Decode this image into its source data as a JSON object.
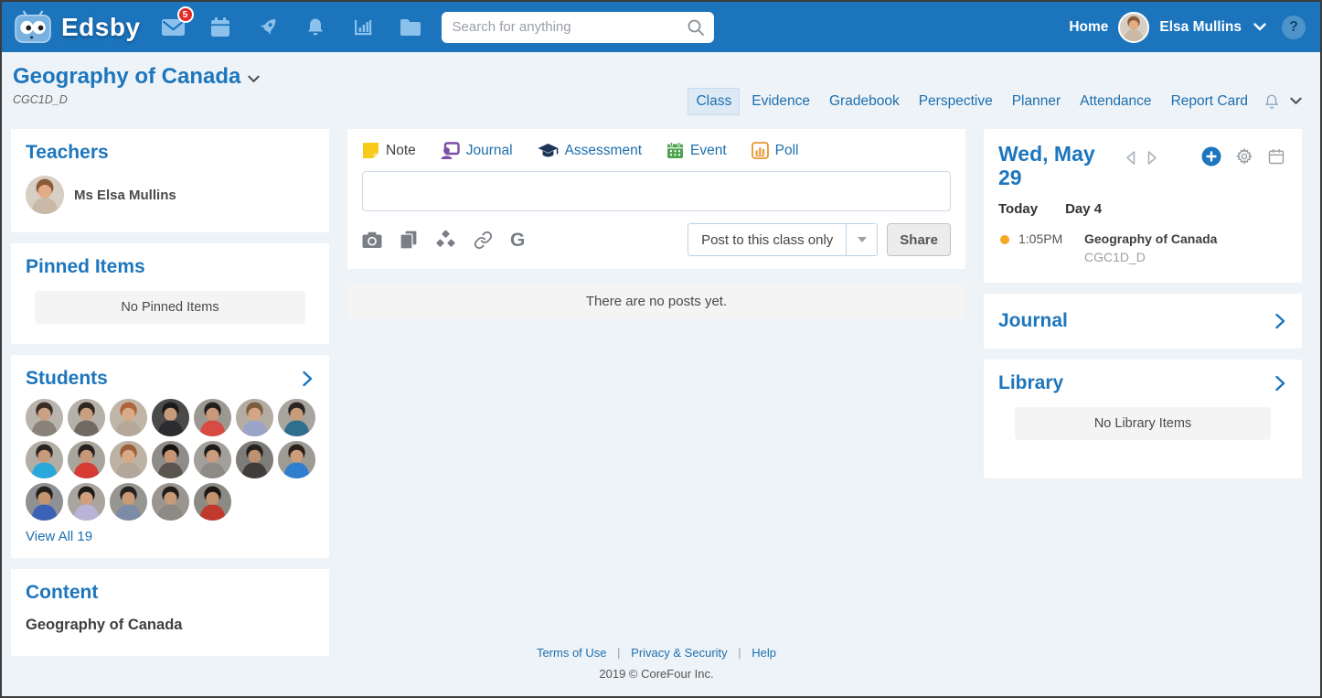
{
  "topbar": {
    "brand": "Edsby",
    "badge_count": "5",
    "search_placeholder": "Search for anything",
    "home_label": "Home",
    "user_name": "Elsa Mullins",
    "help_label": "?"
  },
  "header": {
    "title": "Geography of Canada",
    "code": "CGC1D_D",
    "tabs": [
      "Class",
      "Evidence",
      "Gradebook",
      "Perspective",
      "Planner",
      "Attendance",
      "Report Card"
    ]
  },
  "left": {
    "teachers_title": "Teachers",
    "teacher_name": "Ms Elsa Mullins",
    "pinned_title": "Pinned Items",
    "pinned_empty": "No Pinned Items",
    "students_title": "Students",
    "view_all": "View All 19",
    "content_title": "Content",
    "content_item": "Geography of Canada"
  },
  "composer": {
    "tabs": [
      {
        "label": "Note",
        "icon": "note-icon"
      },
      {
        "label": "Journal",
        "icon": "journal-icon"
      },
      {
        "label": "Assessment",
        "icon": "assessment-icon"
      },
      {
        "label": "Event",
        "icon": "event-icon"
      },
      {
        "label": "Poll",
        "icon": "poll-icon"
      }
    ],
    "google_label": "G",
    "post_target": "Post to this class only",
    "share_label": "Share"
  },
  "feed": {
    "empty_message": "There are no posts yet."
  },
  "right": {
    "date": "Wed, May 29",
    "today_label": "Today",
    "day_label": "Day 4",
    "schedule": [
      {
        "time": "1:05PM",
        "title": "Geography of Canada",
        "code": "CGC1D_D"
      }
    ],
    "journal_title": "Journal",
    "library_title": "Library",
    "library_empty": "No Library Items"
  },
  "footer": {
    "links": [
      "Terms of Use",
      "Privacy & Security",
      "Help"
    ],
    "separator": "|",
    "copyright": "2019 © CoreFour Inc."
  },
  "colors": {
    "topbar_blue": "#1c75bc",
    "icon_light_blue": "#8cc1ec",
    "accent_blue": "#1d76bd",
    "link_blue": "#1d6fae",
    "badge_red": "#e02b27",
    "orange_dot": "#f5a623",
    "note_yellow": "#f6cb1c",
    "journal_purple": "#7b4fa6",
    "assessment_navy": "#1d3557",
    "event_green": "#4da24c",
    "poll_orange": "#e8962e"
  },
  "avatars": {
    "teacher": {
      "bg": "#d8cfc4",
      "hair": "#8a5a3b",
      "skin": "#e2ac85",
      "shirt": "#c9b9a6"
    },
    "user": {
      "bg": "#d8cfc4",
      "hair": "#8a5a3b",
      "skin": "#e2ac85",
      "shirt": "#c9b9a6"
    },
    "students": [
      {
        "bg": "#b9b4ae",
        "hair": "#3a2d26",
        "shirt": "#8a8178",
        "skin": "#caa184"
      },
      {
        "bg": "#b5b0a8",
        "hair": "#2e2620",
        "shirt": "#6f6a62",
        "skin": "#c99f80"
      },
      {
        "bg": "#c0b6a8",
        "hair": "#b0633c",
        "shirt": "#b5a79a",
        "skin": "#d9ab89"
      },
      {
        "bg": "#4a4a4a",
        "hair": "#1d1b1a",
        "shirt": "#2c2c2e",
        "skin": "#c79c7d"
      },
      {
        "bg": "#9b9892",
        "hair": "#241f1d",
        "shirt": "#d84a44",
        "skin": "#c89a78"
      },
      {
        "bg": "#b3aca2",
        "hair": "#7a5b3c",
        "shirt": "#9aa4c8",
        "skin": "#d3a685"
      },
      {
        "bg": "#a8a49e",
        "hair": "#2a2422",
        "shirt": "#2e6f8e",
        "skin": "#c89b7a"
      },
      {
        "bg": "#b2aea6",
        "hair": "#2b2522",
        "shirt": "#29a8dc",
        "skin": "#c79a79"
      },
      {
        "bg": "#a9a49c",
        "hair": "#262120",
        "shirt": "#d63c34",
        "skin": "#c6987a"
      },
      {
        "bg": "#bdb3a4",
        "hair": "#9c5f38",
        "shirt": "#b3a79b",
        "skin": "#d8aa88"
      },
      {
        "bg": "#8f8d89",
        "hair": "#16130f",
        "shirt": "#5b5550",
        "skin": "#c69674"
      },
      {
        "bg": "#a3a09b",
        "hair": "#201c19",
        "shirt": "#8e8a85",
        "skin": "#c99d7e"
      },
      {
        "bg": "#7e7c78",
        "hair": "#26211e",
        "shirt": "#3f3c3a",
        "skin": "#bd9171"
      },
      {
        "bg": "#9e9a94",
        "hair": "#2a211c",
        "shirt": "#2f7fd1",
        "skin": "#cb9d7c"
      },
      {
        "bg": "#8f9094",
        "hair": "#23201c",
        "shirt": "#3b62b5",
        "skin": "#c3966f"
      },
      {
        "bg": "#aaa59f",
        "hair": "#1f1b18",
        "shirt": "#b9b3d6",
        "skin": "#cf9f7f"
      },
      {
        "bg": "#97958f",
        "hair": "#262220",
        "shirt": "#7c8ba6",
        "skin": "#c89a77"
      },
      {
        "bg": "#9a968f",
        "hair": "#211d1a",
        "shirt": "#8d8984",
        "skin": "#c79a79"
      },
      {
        "bg": "#8c8a85",
        "hair": "#1a1715",
        "shirt": "#c0392f",
        "skin": "#c1946f"
      }
    ]
  }
}
